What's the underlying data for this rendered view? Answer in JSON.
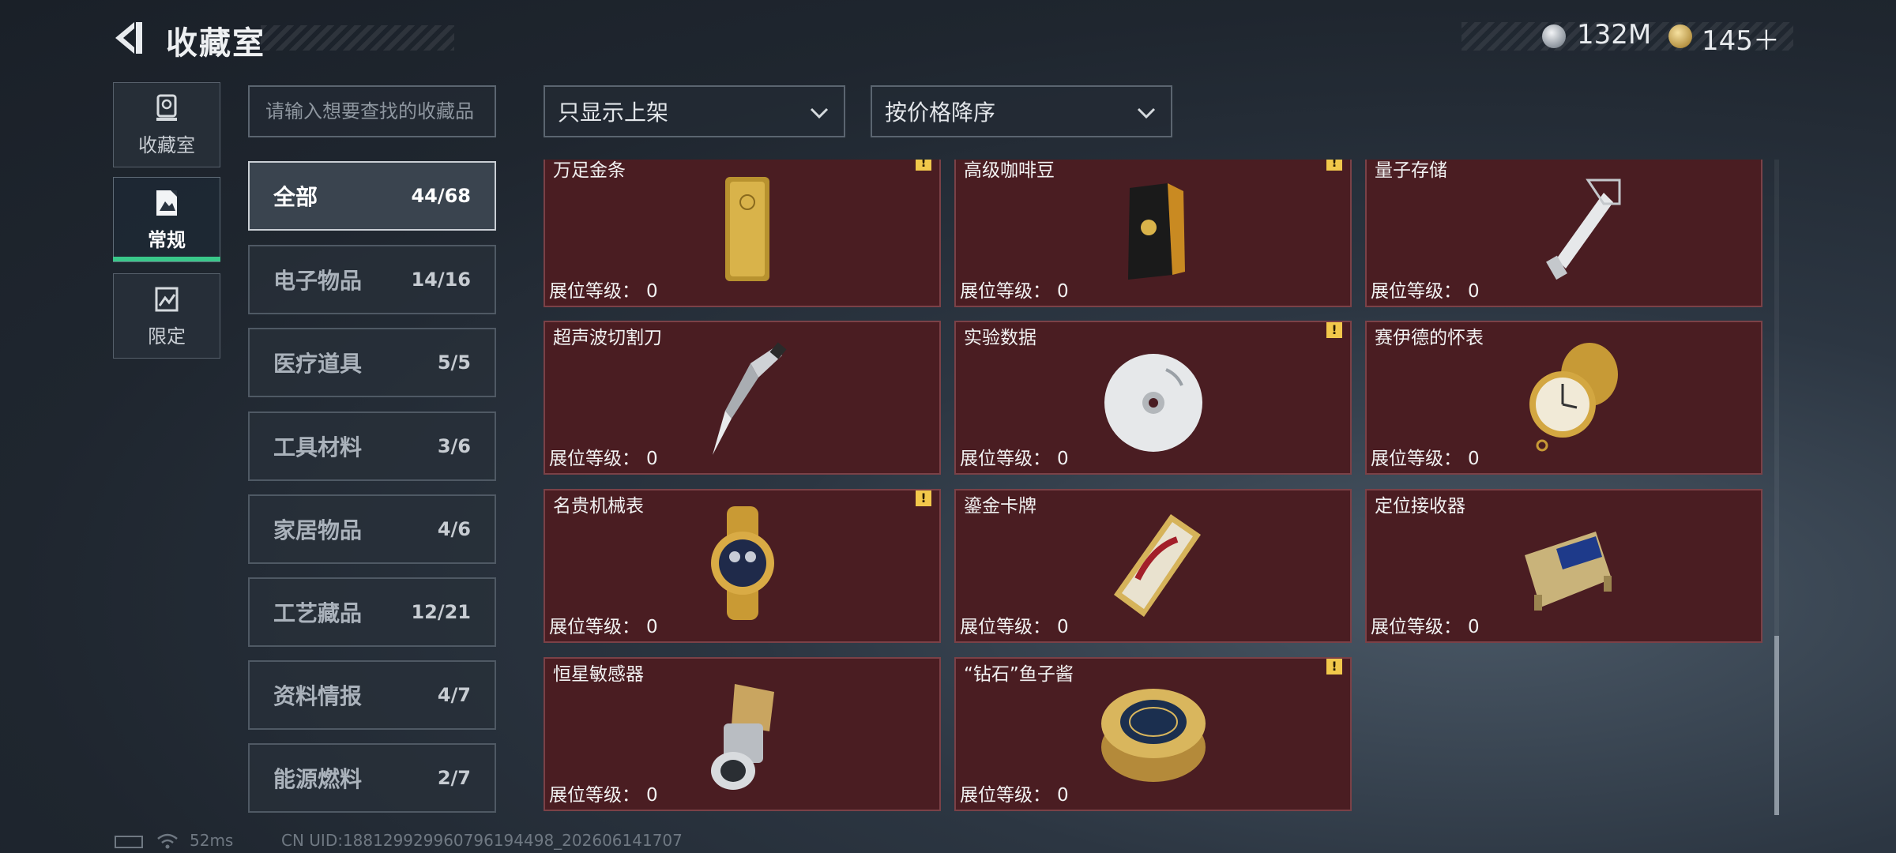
{
  "header": {
    "title": "收藏室",
    "currency": [
      {
        "icon": "silver-coin-icon",
        "value": "132M"
      },
      {
        "icon": "gold-coin-icon",
        "value": "145＋"
      }
    ]
  },
  "side_tabs": [
    {
      "label": "收藏室",
      "icon": "trophy-icon",
      "active": false
    },
    {
      "label": "常规",
      "icon": "regular-collection-icon",
      "active": true
    },
    {
      "label": "限定",
      "icon": "limited-collection-icon",
      "active": false
    }
  ],
  "search": {
    "placeholder": "请输入想要查找的收藏品"
  },
  "filters": {
    "display": "只显示上架",
    "sort": "按价格降序"
  },
  "categories": [
    {
      "name": "全部",
      "count": "44/68",
      "active": true
    },
    {
      "name": "电子物品",
      "count": "14/16"
    },
    {
      "name": "医疗道具",
      "count": "5/5"
    },
    {
      "name": "工具材料",
      "count": "3/6"
    },
    {
      "name": "家居物品",
      "count": "4/6"
    },
    {
      "name": "工艺藏品",
      "count": "12/21"
    },
    {
      "name": "资料情报",
      "count": "4/7"
    },
    {
      "name": "能源燃料",
      "count": "2/7"
    }
  ],
  "level_label": "展位等级：",
  "items": [
    {
      "name": "万足金条",
      "level": "0",
      "warning": true,
      "icon": "gold-bar-icon"
    },
    {
      "name": "高级咖啡豆",
      "level": "0",
      "warning": true,
      "icon": "coffee-bag-icon"
    },
    {
      "name": "量子存储",
      "level": "0",
      "warning": false,
      "icon": "usb-drive-icon"
    },
    {
      "name": "超声波切割刀",
      "level": "0",
      "warning": false,
      "icon": "cutter-knife-icon"
    },
    {
      "name": "实验数据",
      "level": "0",
      "warning": true,
      "icon": "disc-icon"
    },
    {
      "name": "赛伊德的怀表",
      "level": "0",
      "warning": false,
      "icon": "pocket-watch-icon"
    },
    {
      "name": "名贵机械表",
      "level": "0",
      "warning": true,
      "icon": "wristwatch-icon"
    },
    {
      "name": "鎏金卡牌",
      "level": "0",
      "warning": false,
      "icon": "gold-card-icon"
    },
    {
      "name": "定位接收器",
      "level": "0",
      "warning": false,
      "icon": "receiver-device-icon"
    },
    {
      "name": "恒星敏感器",
      "level": "0",
      "warning": false,
      "icon": "star-sensor-icon"
    },
    {
      "name": "“钻石”鱼子酱",
      "level": "0",
      "warning": true,
      "icon": "caviar-tin-icon"
    }
  ],
  "footer": {
    "ping": "52ms",
    "uid": "CN UID:18812992996079619449​8_202606141707"
  }
}
